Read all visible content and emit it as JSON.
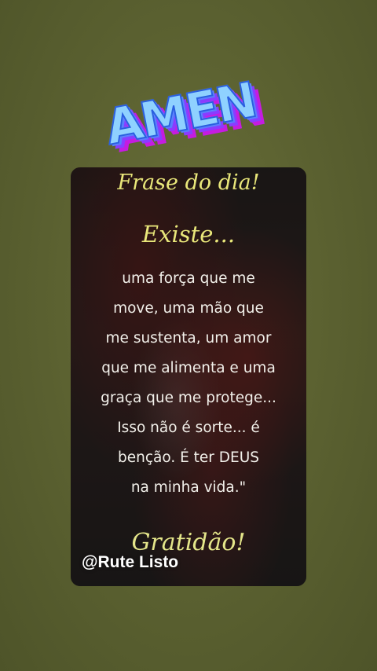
{
  "sticker": {
    "text": "AMEN",
    "colors": {
      "face": "#8fd1ff",
      "outline": "#2a5fe0",
      "extrude_1": "#5a7cff",
      "extrude_2": "#8a3cff",
      "extrude_3": "#c51ce0"
    }
  },
  "card": {
    "title": "Frase do dia!",
    "heading": "Existe...",
    "lines": [
      "uma força que me",
      "move, uma mão que",
      "me sustenta, um amor",
      "que me alimenta e uma",
      "graça que me protege...",
      "Isso não é sorte...  é",
      "benção. É ter DEUS",
      "na minha vida.\""
    ],
    "closing": "Gratidão!",
    "colors": {
      "heading": "#e9e77a",
      "body": "#f2f0ea"
    }
  },
  "watermark": {
    "handle": "@Rute Listo"
  },
  "background": {
    "color": "#5a6030"
  }
}
